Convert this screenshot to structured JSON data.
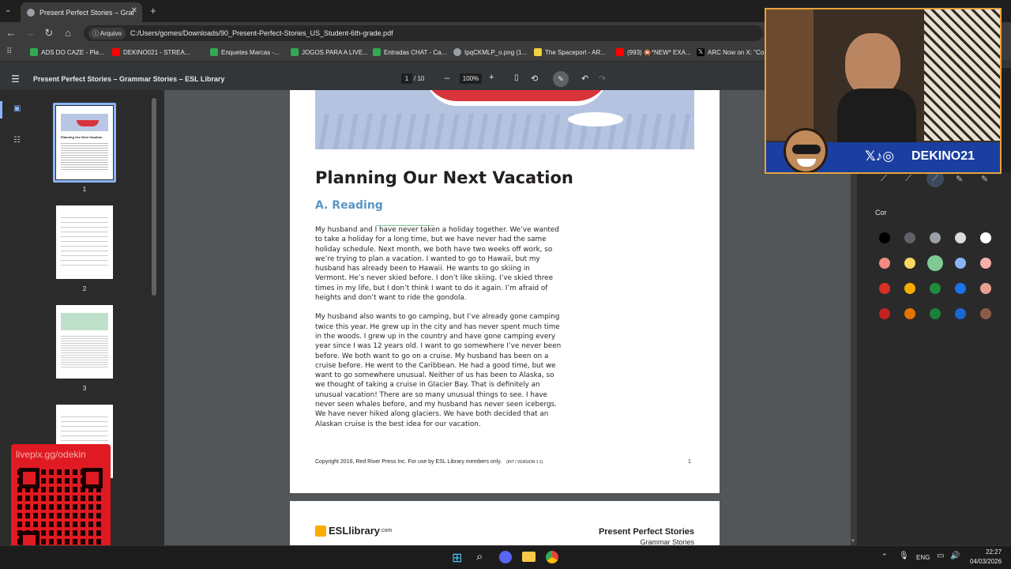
{
  "browser": {
    "tab_title": "Present Perfect Stories – Gramm...",
    "file_chip": "Arquivo",
    "url": "C:/Users/gomes/Downloads/90_Present-Perfect-Stories_US_Student-6th-grade.pdf",
    "bookmarks": [
      {
        "label": "ADS DO CAZE - Pla...",
        "color": "#34a853"
      },
      {
        "label": "DEKINO021 - STREA...",
        "color": "#ff0000"
      },
      {
        "label": "Enquetes Marcas -...",
        "color": "#34a853"
      },
      {
        "label": "JOGOS PARA A LIVE...",
        "color": "#34a853"
      },
      {
        "label": "Entradas CHAT - Ca...",
        "color": "#34a853"
      },
      {
        "label": "IpqCKMLP_o.png (1...",
        "color": "#9aa0a6"
      },
      {
        "label": "The Spaceport - AR...",
        "color": "#f4d03f"
      },
      {
        "label": "(993) 🎇*NEW* EXA...",
        "color": "#ff0000"
      },
      {
        "label": "ARC Now on X: \"Co...",
        "color": "#ffffff"
      }
    ]
  },
  "pdf": {
    "title": "Present Perfect Stories – Grammar Stories – ESL Library",
    "page_current": "1",
    "page_total": "/ 10",
    "zoom": "100%",
    "minus": "–",
    "plus": "+"
  },
  "thumbnails": [
    {
      "label": "1"
    },
    {
      "label": "2"
    },
    {
      "label": "3"
    }
  ],
  "thumb_mini_title": "Planning Our Next Vacation",
  "page1": {
    "heading": "Planning Our Next Vacation",
    "subheading": "A. Reading",
    "paragraph1": "My husband and I have never taken a holiday together. We’ve wanted to take a holiday for a long time, but we have never had the same holiday schedule. Next month, we both have two weeks off work, so we’re trying to plan a vacation. I wanted to go to Hawaii, but my husband has already been to Hawaii. He wants to go skiing in Vermont. He’s never skied before. I don’t like skiing. I’ve skied three times in my life, but I don’t think I want to do it again. I’m afraid of heights and don’t want to ride the gondola.",
    "paragraph2": "My husband also wants to go camping, but I’ve already gone camping twice this year. He grew up in the city and has never spent much time in the woods. I grew up in the country and have gone camping every year since I was 12 years old. I want to go somewhere I’ve never been before. We both want to go on a cruise. My husband has been on a cruise before. He went to the Caribbean. He had a good time, but we want to go somewhere unusual. Neither of us has been to Alaska, so we thought of taking a cruise in Glacier Bay. That is definitely an unusual vacation! There are so many unusual things to see. I have never seen whales before, and my husband has never seen icebergs. We have never hiked along glaciers. We have both decided that an Alaskan cruise is the best idea for our vacation.",
    "footer_copyright": "Copyright 2016, Red River Press Inc. For use by ESL Library members only.",
    "footer_version": "(INT / VERSION 1.1)",
    "footer_page": "1"
  },
  "page2": {
    "logo": "ESLlibrary",
    "logo_suffix": ".com",
    "title": "Present Perfect Stories",
    "subtitle": "Grammar Stories"
  },
  "annotation": {
    "color_label": "Cor",
    "colors": [
      [
        "#000000",
        "#5f6368",
        "#9aa0a6",
        "#dadce0",
        "#ffffff"
      ],
      [
        "#f28b82",
        "#fdd663",
        "#81c995",
        "#8ab4f8",
        "#f6aea9"
      ],
      [
        "#d93025",
        "#f9ab00",
        "#1e8e3e",
        "#1a73e8",
        "#e8a090"
      ],
      [
        "#c5221f",
        "#e37400",
        "#188038",
        "#1967d2",
        "#8d5a4a"
      ]
    ]
  },
  "overlay": {
    "social_handle": "DEKINO21",
    "livepix": "livepix.gg/odekin"
  },
  "taskbar": {
    "lang": "ENG",
    "time": "22:27",
    "date": "04/03/2026"
  }
}
